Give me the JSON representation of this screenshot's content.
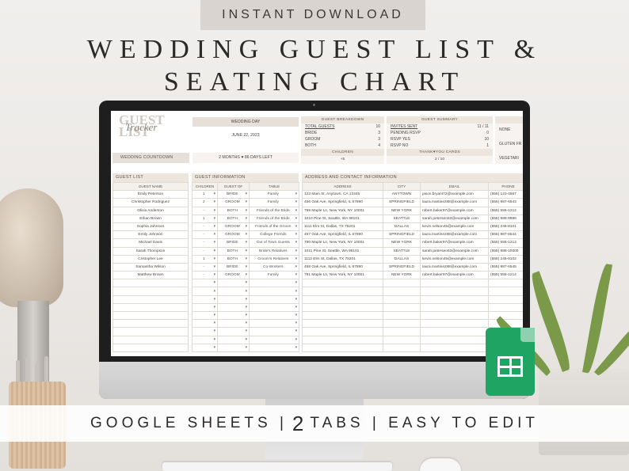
{
  "banner_top": "INSTANT DOWNLOAD",
  "title_line1": "WEDDING GUEST LIST &",
  "title_line2": "SEATING CHART",
  "bottom_banner": {
    "left": "GOOGLE SHEETS  |",
    "number": "2",
    "right": "TABS  |  EASY TO EDIT"
  },
  "sheet": {
    "logo": {
      "line1": "GUEST",
      "script": "Tracker",
      "line2": "LIST"
    },
    "wedding_day_label": "WEDDING DAY",
    "wedding_date": "JUNE 22, 2023",
    "countdown_label": "WEDDING COUNTDOWN",
    "countdown_value": "2 MONTHS  ♥  86 DAYS LEFT",
    "breakdown": {
      "header": "GUEST BREAKDOWN",
      "rows": [
        {
          "label": "TOTAL GUESTS",
          "value": "10"
        },
        {
          "label": "BRIDE",
          "value": "3"
        },
        {
          "label": "GROOM",
          "value": "3"
        },
        {
          "label": "BOTH",
          "value": "4"
        }
      ],
      "children_header": "CHILDREN",
      "children_value": "+5"
    },
    "summary": {
      "header": "GUEST SUMMARY",
      "rows": [
        {
          "label": "INVITES SENT",
          "value": "11 / 11"
        },
        {
          "label": "PENDING RSVP",
          "value": "0"
        },
        {
          "label": "RSVP YES",
          "value": "10"
        },
        {
          "label": "RSVP NO",
          "value": "1"
        }
      ],
      "thank_header": "THANK♥YOU CARDS",
      "thank_value": "2 / 10"
    },
    "extra": {
      "items": [
        "NONE",
        "GLUTEN FR",
        "VEGETARI"
      ]
    },
    "guest_list": {
      "section": "GUEST LIST",
      "col": "GUEST NAME",
      "names": [
        "Emily Peterson",
        "Christopher Rodriguez",
        "Olivia Anderson",
        "Ethan Brown",
        "Sophia Johnson",
        "Emily Johnson",
        "Michael Davis",
        "Sarah Thompson",
        "Cristopher Lee",
        "Samantha Wilson",
        "Matthew Brown"
      ]
    },
    "guest_info": {
      "section": "GUEST INFORMATION",
      "cols": [
        "CHILDREN",
        "GUEST OF",
        "TABLE"
      ],
      "rows": [
        {
          "children": "1",
          "of": "BRIDE",
          "table": "Family"
        },
        {
          "children": "2",
          "of": "GROOM",
          "table": "Family"
        },
        {
          "children": "-",
          "of": "BOTH",
          "table": "Friends of the Bride"
        },
        {
          "children": "1",
          "of": "BOTH",
          "table": "Friends of the Bride"
        },
        {
          "children": "-",
          "of": "GROOM",
          "table": "Friends of the Groom"
        },
        {
          "children": "-",
          "of": "GROOM",
          "table": "College Friends"
        },
        {
          "children": "-",
          "of": "BRIDE",
          "table": "Out of Town Guests"
        },
        {
          "children": "-",
          "of": "BOTH",
          "table": "Bride's Relatives"
        },
        {
          "children": "1",
          "of": "BOTH",
          "table": "Groom's Relatives"
        },
        {
          "children": "-",
          "of": "BRIDE",
          "table": "Co-Workers"
        },
        {
          "children": "-",
          "of": "GROOM",
          "table": "Family"
        }
      ]
    },
    "address": {
      "section": "ADDRESS AND CONTACT INFORMATION",
      "cols": [
        "ADDRESS",
        "CITY",
        "EMAIL",
        "PHONE"
      ],
      "rows": [
        {
          "address": "123 Main St, Anytown, CA 12345",
          "city": "ANYTOWN",
          "email": "jason.bryant72@example.com",
          "phone": "(555) 123-4567"
        },
        {
          "address": "456 Oak Ave, Springfield, IL 67890",
          "city": "SPRINGFIELD",
          "email": "laura.martinez88@example.com",
          "phone": "(555) 987-6543"
        },
        {
          "address": "789 Maple Ln, New York, NY 10001",
          "city": "NEW YORK",
          "email": "robert.baker97@example.com",
          "phone": "(555) 555-1212"
        },
        {
          "address": "1010 Pine St, Seattle, WA 98101",
          "city": "SEATTLE",
          "email": "sarah.petersen63@example.com",
          "phone": "(555) 888-9999"
        },
        {
          "address": "1111 Elm St, Dallas, TX 75201",
          "city": "DALLAS",
          "email": "kevin.nelson45@example.com",
          "phone": "(555) 246-8101"
        },
        {
          "address": "457 Oak Ave, Springfield, IL 67890",
          "city": "SPRINGFIELD",
          "email": "laura.martinez88@example.com",
          "phone": "(555) 987-6544"
        },
        {
          "address": "790 Maple Ln, New York, NY 10001",
          "city": "NEW YORK",
          "email": "robert.baker97@example.com",
          "phone": "(555) 555-1213"
        },
        {
          "address": "1011 Pine St, Seattle, WA 98101",
          "city": "SEATTLE",
          "email": "sarah.petersen63@example.com",
          "phone": "(555) 888-10000"
        },
        {
          "address": "1112 Elm St, Dallas, TX 75201",
          "city": "DALLAS",
          "email": "kevin.nelson45@example.com",
          "phone": "(555) 246-8102"
        },
        {
          "address": "458 Oak Ave, Springfield, IL 67890",
          "city": "SPRINGFIELD",
          "email": "laura.martinez88@example.com",
          "phone": "(555) 987-6545"
        },
        {
          "address": "791 Maple Ln, New York, NY 10001",
          "city": "NEW YORK",
          "email": "robert.baker97@example.com",
          "phone": "(555) 555-1214"
        }
      ]
    }
  },
  "colors": {
    "accent": "#ece6df",
    "sheets_green": "#1fa463"
  },
  "icons": [
    "google-sheets-icon",
    "heart-icon",
    "dropdown-arrow-icon"
  ]
}
